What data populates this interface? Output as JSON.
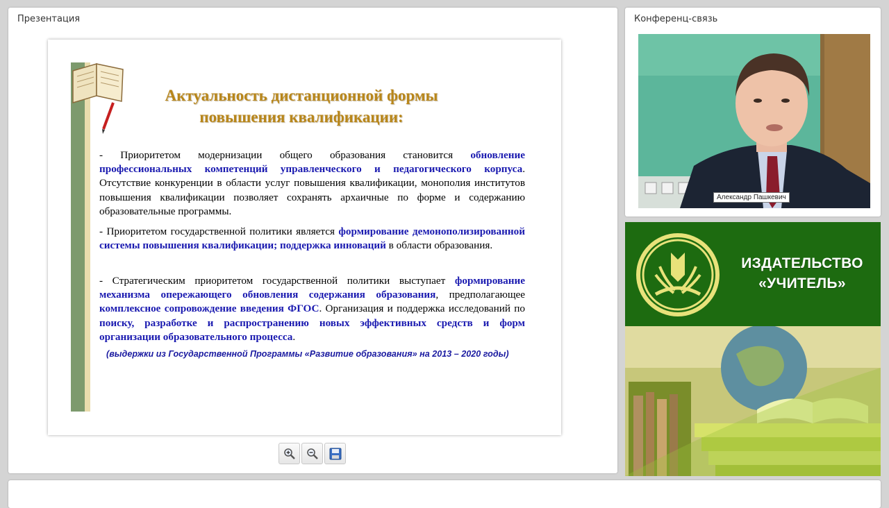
{
  "presentation_panel": {
    "title": "Презентация",
    "slide": {
      "title_line1": "Актуальность дистанционной формы",
      "title_line2": "повышения квалификации:",
      "p1": {
        "t1": "- Приоритетом модернизации общего образования становится ",
        "b1": "обновление профессиональных компетенций управленческого и педагогического корпуса",
        "t2": ". Отсутствие конкуренции в области услуг повышения квалификации, монополия институтов повышения квалификации позволяет сохранять архаичные по форме и содержанию образовательные программы."
      },
      "p2": {
        "t1": "- Приоритетом государственной политики является ",
        "b1": "формирование демонополизированной системы повышения квалификации; поддержка инноваций",
        "t2": " в области образования."
      },
      "p3": {
        "t1": "- Стратегическим приоритетом государственной политики выступает ",
        "b1": "формирование механизма опережающего обновления содержания образования",
        "t2": ", предполагающее ",
        "b2": "комплексное сопровождение введения ФГОС",
        "t3": ". Организация и поддержка исследований по ",
        "b3": "поиску, разработке и распространению новых эффективных средств и форм организации образовательного процесса",
        "t4": "."
      },
      "source": "(выдержки из  Государственной Программы «Развитие образования» на 2013 – 2020 годы)"
    },
    "toolbar": {
      "zoom_in_icon": "zoom-in-icon",
      "zoom_out_icon": "zoom-out-icon",
      "save_icon": "floppy-disk-icon"
    }
  },
  "conference_panel": {
    "title": "Конференц-связь",
    "speaker_name": "Александр Пашкевич"
  },
  "banner": {
    "line1": "ИЗДАТЕЛЬСТВО",
    "line2": "«УЧИТЕЛЬ»",
    "brand_green": "#1d6b10"
  }
}
